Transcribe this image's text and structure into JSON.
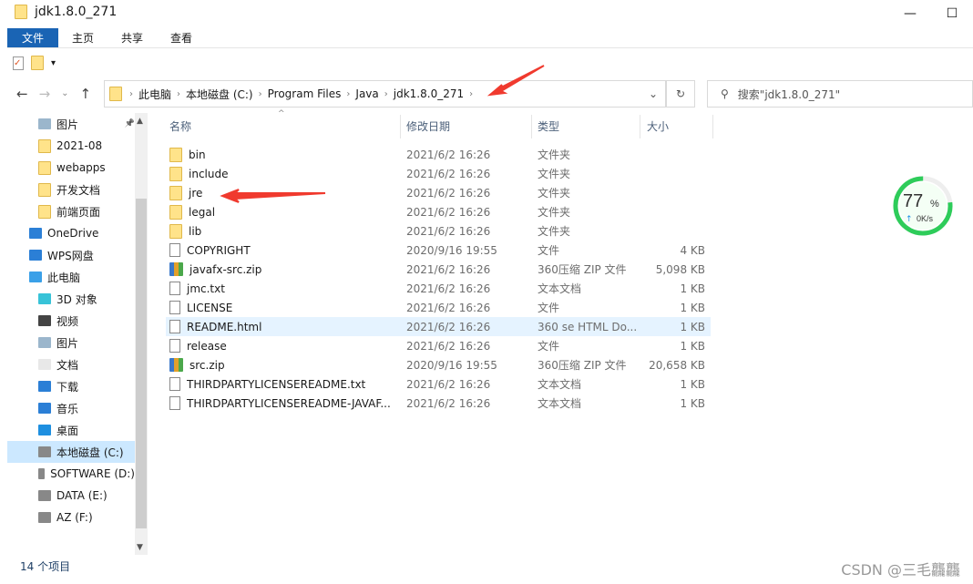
{
  "window": {
    "title": "jdk1.8.0_271",
    "buttons": [
      "—",
      "☐"
    ]
  },
  "ribbon": {
    "tabs": [
      {
        "label": "文件",
        "active": true
      },
      {
        "label": "主页"
      },
      {
        "label": "共享"
      },
      {
        "label": "查看"
      }
    ]
  },
  "address": {
    "crumbs": [
      "此电脑",
      "本地磁盘 (C:)",
      "Program Files",
      "Java",
      "jdk1.8.0_271"
    ]
  },
  "search": {
    "placeholder": "搜索\"jdk1.8.0_271\""
  },
  "sidebar": {
    "items": [
      {
        "label": "图片",
        "icon": "pictures-icon",
        "indent": 1,
        "pinned": true
      },
      {
        "label": "2021-08",
        "icon": "folder-icon",
        "indent": 1
      },
      {
        "label": "webapps",
        "icon": "folder-icon",
        "indent": 1
      },
      {
        "label": "开发文档",
        "icon": "folder-icon",
        "indent": 1
      },
      {
        "label": "前端页面",
        "icon": "folder-icon",
        "indent": 1
      },
      {
        "label": "OneDrive",
        "icon": "cloud-icon",
        "indent": 0
      },
      {
        "label": "WPS网盘",
        "icon": "cloud-icon",
        "indent": 0
      },
      {
        "label": "此电脑",
        "icon": "computer-icon",
        "indent": 0
      },
      {
        "label": "3D 对象",
        "icon": "cube-icon",
        "indent": 1
      },
      {
        "label": "视频",
        "icon": "video-icon",
        "indent": 1
      },
      {
        "label": "图片",
        "icon": "pictures-icon",
        "indent": 1
      },
      {
        "label": "文档",
        "icon": "document-icon",
        "indent": 1
      },
      {
        "label": "下载",
        "icon": "download-icon",
        "indent": 1
      },
      {
        "label": "音乐",
        "icon": "music-icon",
        "indent": 1
      },
      {
        "label": "桌面",
        "icon": "desktop-icon",
        "indent": 1
      },
      {
        "label": "本地磁盘 (C:)",
        "icon": "drive-icon",
        "indent": 1,
        "selected": true
      },
      {
        "label": "SOFTWARE (D:)",
        "icon": "drive-icon",
        "indent": 1
      },
      {
        "label": "DATA (E:)",
        "icon": "drive-icon",
        "indent": 1
      },
      {
        "label": "AZ (F:)",
        "icon": "drive-icon",
        "indent": 1
      }
    ]
  },
  "columns": {
    "name": "名称",
    "date": "修改日期",
    "type": "类型",
    "size": "大小"
  },
  "files": [
    {
      "name": "bin",
      "date": "2021/6/2 16:26",
      "type": "文件夹",
      "size": "",
      "kind": "folder"
    },
    {
      "name": "include",
      "date": "2021/6/2 16:26",
      "type": "文件夹",
      "size": "",
      "kind": "folder"
    },
    {
      "name": "jre",
      "date": "2021/6/2 16:26",
      "type": "文件夹",
      "size": "",
      "kind": "folder"
    },
    {
      "name": "legal",
      "date": "2021/6/2 16:26",
      "type": "文件夹",
      "size": "",
      "kind": "folder"
    },
    {
      "name": "lib",
      "date": "2021/6/2 16:26",
      "type": "文件夹",
      "size": "",
      "kind": "folder"
    },
    {
      "name": "COPYRIGHT",
      "date": "2020/9/16 19:55",
      "type": "文件",
      "size": "4 KB",
      "kind": "file"
    },
    {
      "name": "javafx-src.zip",
      "date": "2021/6/2 16:26",
      "type": "360压缩 ZIP 文件",
      "size": "5,098 KB",
      "kind": "zip"
    },
    {
      "name": "jmc.txt",
      "date": "2021/6/2 16:26",
      "type": "文本文档",
      "size": "1 KB",
      "kind": "file"
    },
    {
      "name": "LICENSE",
      "date": "2021/6/2 16:26",
      "type": "文件",
      "size": "1 KB",
      "kind": "file"
    },
    {
      "name": "README.html",
      "date": "2021/6/2 16:26",
      "type": "360 se HTML Do...",
      "size": "1 KB",
      "kind": "file",
      "hover": true
    },
    {
      "name": "release",
      "date": "2021/6/2 16:26",
      "type": "文件",
      "size": "1 KB",
      "kind": "file"
    },
    {
      "name": "src.zip",
      "date": "2020/9/16 19:55",
      "type": "360压缩 ZIP 文件",
      "size": "20,658 KB",
      "kind": "zip"
    },
    {
      "name": "THIRDPARTYLICENSEREADME.txt",
      "date": "2021/6/2 16:26",
      "type": "文本文档",
      "size": "1 KB",
      "kind": "file"
    },
    {
      "name": "THIRDPARTYLICENSEREADME-JAVAF...",
      "date": "2021/6/2 16:26",
      "type": "文本文档",
      "size": "1 KB",
      "kind": "file"
    }
  ],
  "status": {
    "count": "14 个项目"
  },
  "gauge": {
    "percent": 77,
    "label": "77",
    "unit": "%",
    "speed": "0K/s",
    "color": "#2ecc5a"
  },
  "watermark": "CSDN @三毛龘龘",
  "annotation_color": "#f03a2e"
}
